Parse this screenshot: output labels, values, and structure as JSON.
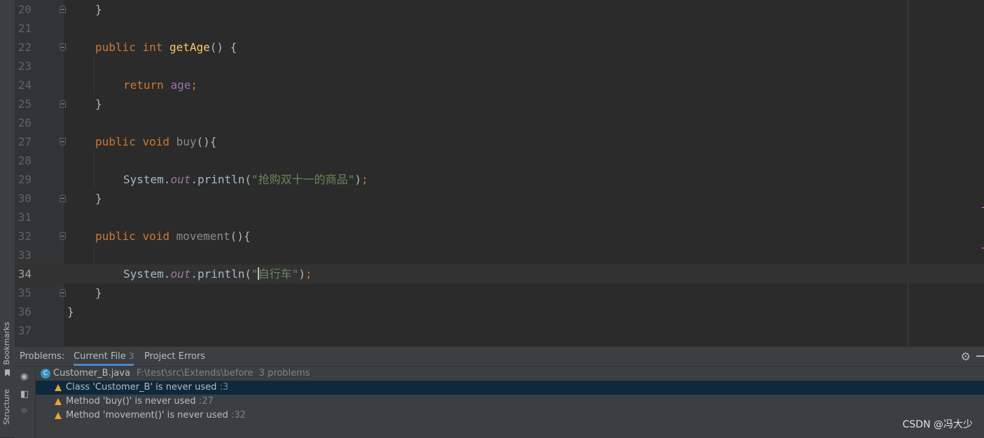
{
  "tool_strip": {
    "bookmarks_label": "Bookmarks",
    "structure_label": "Structure"
  },
  "editor": {
    "lines": [
      {
        "number": "20"
      },
      {
        "number": "21"
      },
      {
        "number": "22",
        "kw1": "public",
        "kw2": "int",
        "fn": "getAge",
        "rest": "() {"
      },
      {
        "number": "23"
      },
      {
        "number": "24",
        "kw": "return",
        "field": "age",
        "semi": ";"
      },
      {
        "number": "25"
      },
      {
        "number": "26"
      },
      {
        "number": "27",
        "kw1": "public",
        "kw2": "void",
        "fn": "buy",
        "rest": "(){"
      },
      {
        "number": "28"
      },
      {
        "number": "29",
        "cls": "System",
        "dot1": ".",
        "static_field": "out",
        "call": ".println(",
        "str": "\"抢购双十一的商品\"",
        "close": ")",
        "semi": ";"
      },
      {
        "number": "30"
      },
      {
        "number": "31"
      },
      {
        "number": "32",
        "kw1": "public",
        "kw2": "void",
        "fn": "movement",
        "rest": "(){"
      },
      {
        "number": "33"
      },
      {
        "number": "34",
        "cls": "System",
        "dot1": ".",
        "static_field": "out",
        "call": ".println(",
        "str_open": "\"",
        "str_rest": "自行车\"",
        "close": ")",
        "semi": ";"
      },
      {
        "number": "35"
      },
      {
        "number": "36"
      },
      {
        "number": "37"
      }
    ],
    "brace": "}"
  },
  "problems": {
    "title": "Problems:",
    "tabs": [
      {
        "label": "Current File",
        "count": "3"
      },
      {
        "label": "Project Errors"
      }
    ],
    "file": {
      "icon_letter": "C",
      "name": "Customer_B.java",
      "path": "F:\\test\\src\\Extends\\before",
      "summary": "3 problems"
    },
    "items": [
      {
        "text": "Class 'Customer_B' is never used",
        "line": ":3"
      },
      {
        "text": "Method 'buy()' is never used",
        "line": ":27"
      },
      {
        "text": "Method 'movement()' is never used",
        "line": ":32"
      }
    ],
    "icons": {
      "settings": "gear-icon",
      "hide": "hide-icon",
      "preview": "eye-icon",
      "autoscroll": "preview-icon",
      "expand": "expand-all-icon"
    }
  },
  "watermark": "CSDN @冯大少"
}
